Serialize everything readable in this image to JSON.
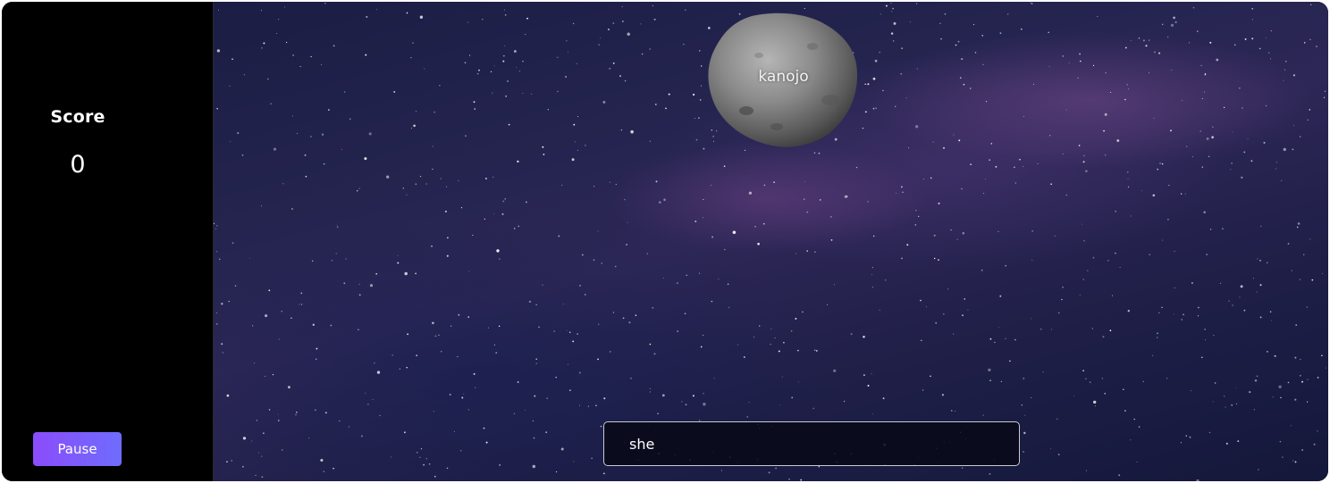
{
  "sidebar": {
    "score_label": "Score",
    "score_value": "0",
    "pause_label": "Pause"
  },
  "game": {
    "falling_word": "kanojo",
    "input_value": "she",
    "accent_color": "#8b4cfb"
  }
}
